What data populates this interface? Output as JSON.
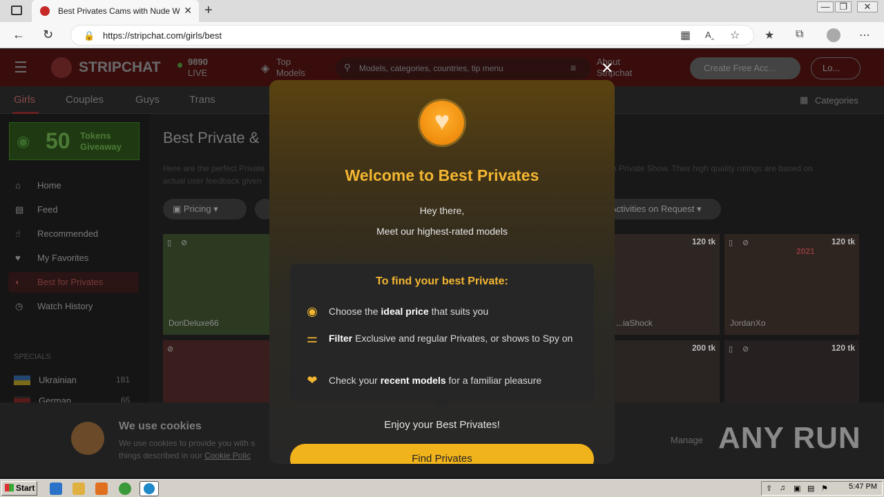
{
  "browser": {
    "tab_title": "Best Privates Cams with Nude Wo",
    "tab_close": "✕",
    "new_tab": "+",
    "url": "https://stripchat.com/girls/best",
    "window_controls": [
      "—",
      "❐",
      "✕"
    ]
  },
  "site": {
    "brand": "STRIPCHAT",
    "live_count": "9890",
    "live_label": "LIVE",
    "top_models": "Top Models",
    "search_placeholder": "Models, categories, countries, tip menu",
    "about": "About Stripchat",
    "create_account": "Create Free Acc...",
    "login": "Lo...",
    "nav_tabs": [
      "Girls",
      "Couples",
      "Guys",
      "Trans"
    ],
    "categories": "Categories",
    "giveaway_number": "50",
    "giveaway_text": "Tokens Giveaway",
    "sidebar": {
      "items": [
        {
          "label": "Home",
          "icon": "home-icon"
        },
        {
          "label": "Feed",
          "icon": "feed-icon"
        },
        {
          "label": "Recommended",
          "icon": "thumbs-up-icon"
        },
        {
          "label": "My Favorites",
          "icon": "heart-icon"
        },
        {
          "label": "Best for Privates",
          "icon": "privates-icon"
        },
        {
          "label": "Watch History",
          "icon": "history-icon"
        }
      ],
      "specials_label": "SPECIALS",
      "specials": [
        {
          "label": "Ukrainian",
          "count": "181"
        },
        {
          "label": "German",
          "count": "65"
        }
      ]
    },
    "page_title": "Best Private &",
    "page_desc_left": "Here are the perfect Private",
    "page_desc_left2": "actual user feedback given",
    "page_desc_right": "n Private Show. Their high quality ratings are based on",
    "filters": {
      "pricing": "Pricing",
      "activities": "Activities on Request"
    },
    "cards": [
      {
        "name": "DoriDeluxe66",
        "price": ""
      },
      {
        "name": "...iaShock",
        "price": "120 tk"
      },
      {
        "name": "JordanXo",
        "price": "120 tk",
        "badge": "2021"
      },
      {
        "name": "",
        "price": "200 tk"
      },
      {
        "name": "",
        "price": "120 tk"
      }
    ]
  },
  "cookie": {
    "title": "We use cookies",
    "desc1": "We use cookies to provide you with s",
    "desc2": "things described in our",
    "link": "Cookie Polic",
    "manage": "Manage"
  },
  "watermark": "ANY RUN",
  "modal": {
    "close": "✕",
    "title": "Welcome to Best Privates",
    "greeting": "Hey there,",
    "subtitle": "Meet our highest-rated models",
    "features_title": "To find your best Private:",
    "features": [
      {
        "pre": "Choose the ",
        "bold": "ideal price",
        "post": " that suits you",
        "icon": "coins-icon"
      },
      {
        "pre": "",
        "bold": "Filter",
        "post": " Exclusive and regular Privates, or shows to Spy on",
        "icon": "filter-icon"
      },
      {
        "pre": "Check your ",
        "bold": "recent models",
        "post": " for a familiar pleasure",
        "icon": "heart-hand-icon"
      }
    ],
    "enjoy": "Enjoy your Best Privates!",
    "cta": "Find Privates"
  },
  "taskbar": {
    "start": "Start",
    "clock": "5:47 PM"
  },
  "colors": {
    "accent": "#f3b631",
    "button": "#f0b31c",
    "site_header": "#3a0d0d"
  }
}
